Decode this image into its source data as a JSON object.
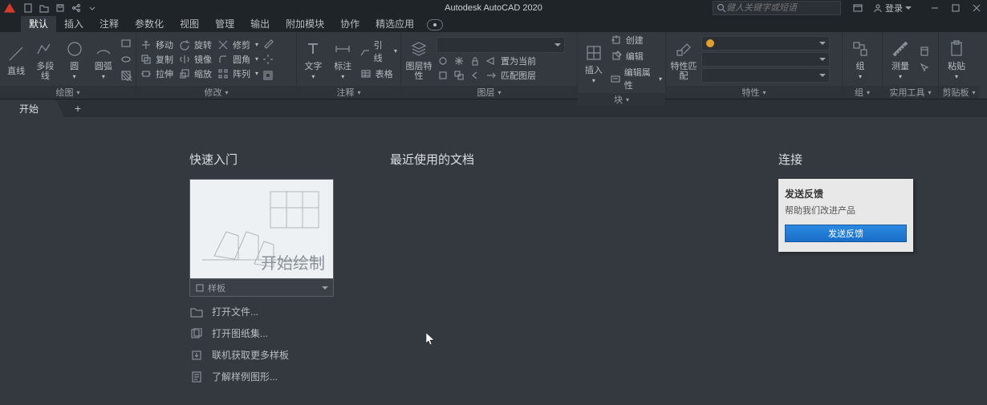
{
  "title": "Autodesk AutoCAD 2020",
  "search_placeholder": "健人关键字或短语",
  "login_label": "登录",
  "menu_tabs": [
    "默认",
    "插入",
    "注释",
    "参数化",
    "视图",
    "管理",
    "输出",
    "附加模块",
    "协作",
    "精选应用"
  ],
  "menu_active": 0,
  "ribbon": {
    "draw": {
      "title": "绘图",
      "line": "直线",
      "polyline": "多段线",
      "circle": "圆",
      "arc": "圆弧"
    },
    "modify": {
      "title": "修改",
      "move": "移动",
      "rotate": "旋转",
      "trim": "修剪",
      "copy": "复制",
      "mirror": "镜像",
      "fillet": "圆角",
      "stretch": "拉伸",
      "scale": "缩放",
      "array": "阵列"
    },
    "annotate": {
      "title": "注释",
      "text": "文字",
      "dim": "标注",
      "leader": "引线",
      "table": "表格"
    },
    "layer": {
      "title": "图层",
      "props": "图层特性",
      "setcur": "置为当前",
      "match": "匹配图层"
    },
    "block": {
      "title": "块",
      "insert": "插入",
      "create": "创建",
      "edit": "编辑",
      "editattr": "编辑属性"
    },
    "props": {
      "title": "特性",
      "match": "特性匹配"
    },
    "group": {
      "title": "组",
      "group": "组"
    },
    "utils": {
      "title": "实用工具",
      "measure": "测量"
    },
    "clip": {
      "title": "剪贴板",
      "paste": "粘贴"
    }
  },
  "doc_tab": "开始",
  "start": {
    "quickstart": "快速入门",
    "start_draw": "开始绘制",
    "template_label": "样板",
    "links": [
      "打开文件...",
      "打开图纸集...",
      "联机获取更多样板",
      "了解样例图形..."
    ],
    "recent": "最近使用的文档",
    "connect": "连接",
    "feedback_title": "发送反馈",
    "feedback_sub": "帮助我们改进产品",
    "feedback_btn": "发送反馈"
  }
}
